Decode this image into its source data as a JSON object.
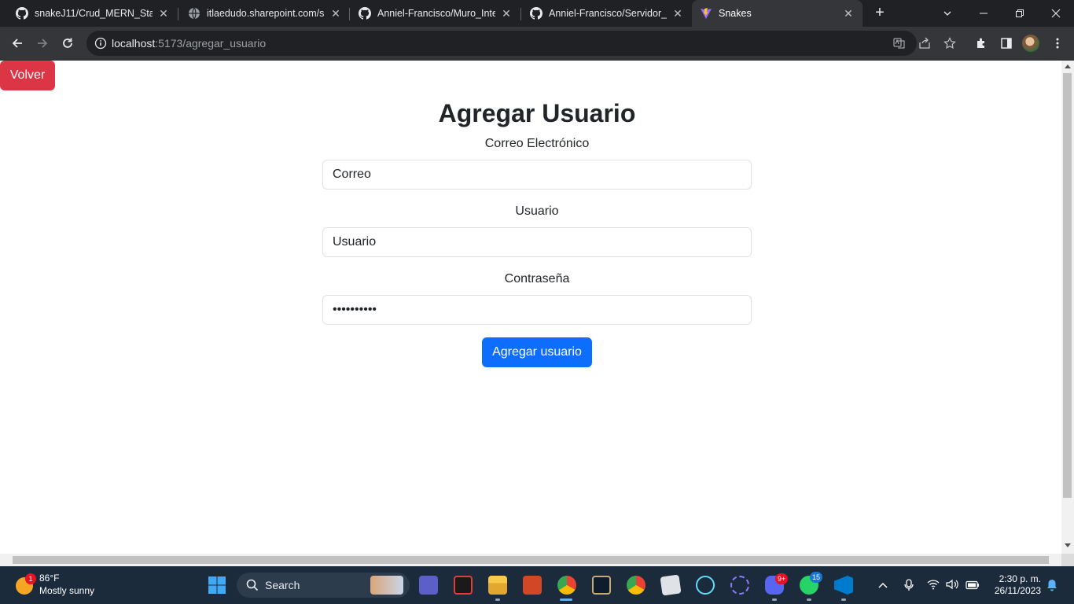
{
  "browser": {
    "tabs": [
      {
        "title": "snakeJ11/Crud_MERN_Stack",
        "icon": "github-icon"
      },
      {
        "title": "itlaedudo.sharepoint.com/si",
        "icon": "globe-icon"
      },
      {
        "title": "Anniel-Francisco/Muro_Inter",
        "icon": "github-icon"
      },
      {
        "title": "Anniel-Francisco/Servidor_M",
        "icon": "github-icon"
      },
      {
        "title": "Snakes",
        "icon": "vite-icon",
        "active": true
      }
    ],
    "url_host": "localhost",
    "url_path": ":5173/agregar_usuario"
  },
  "page": {
    "back_button": "Volver",
    "title": "Agregar Usuario",
    "email_label": "Correo Electrónico",
    "email_value": "Correo",
    "user_label": "Usuario",
    "user_value": "Usuario",
    "password_label": "Contraseña",
    "password_value": "••••••••••",
    "submit_button": "Agregar usuario"
  },
  "taskbar": {
    "weather_badge": "1",
    "temperature": "86°F",
    "condition": "Mostly sunny",
    "search_label": "Search",
    "discord_badge": "9+",
    "whatsapp_badge": "15",
    "time": "2:30 p. m.",
    "date": "26/11/2023"
  },
  "colors": {
    "danger": "#dc3545",
    "primary": "#0d6efd",
    "chrome_dark": "#202124",
    "taskbar": "#1c2b3c"
  }
}
